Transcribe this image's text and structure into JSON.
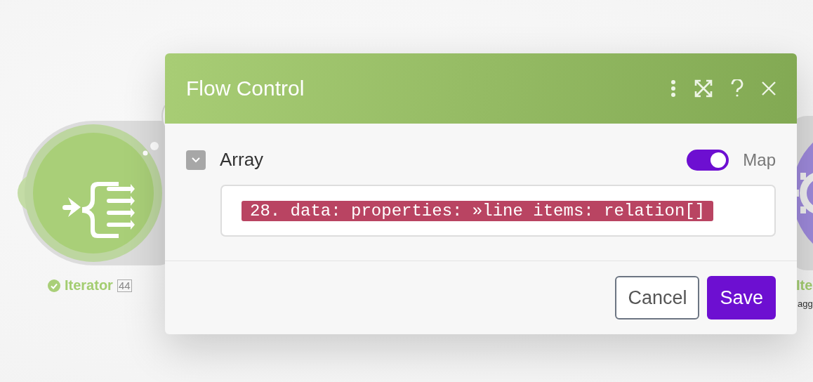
{
  "modules": [
    {
      "kind": "iterator",
      "name": "Iterator",
      "succeeded": true,
      "count": "44"
    },
    {
      "kind": "aggregator",
      "name": "Ite",
      "subtitle": "agg"
    }
  ],
  "dialog": {
    "title": "Flow Control",
    "field": {
      "label": "Array",
      "expanded": true,
      "map": {
        "label": "Map",
        "on": true
      },
      "value": "28. data: properties: »line items: relation[]"
    },
    "buttons": [
      {
        "label": "Cancel",
        "kind": "secondary"
      },
      {
        "label": "Save",
        "kind": "primary"
      }
    ]
  }
}
